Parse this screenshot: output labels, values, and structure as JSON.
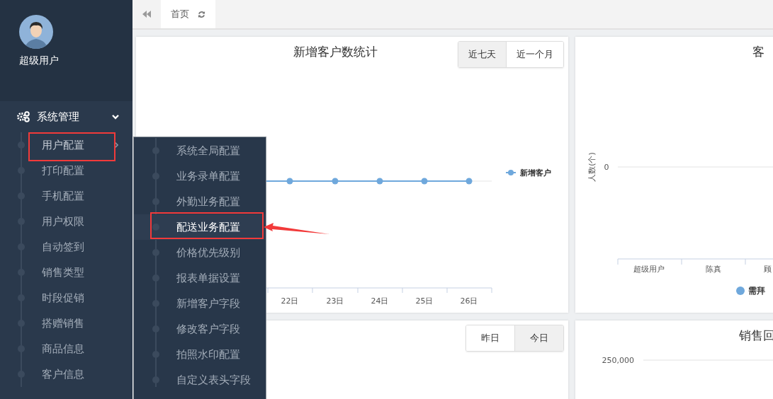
{
  "sidebar": {
    "user_name": "超级用户",
    "menu": {
      "label": "系统管理",
      "expanded": true,
      "children": [
        {
          "label": "用户配置",
          "selected": true
        },
        {
          "label": "打印配置",
          "selected": false
        },
        {
          "label": "手机配置",
          "selected": false
        },
        {
          "label": "用户权限",
          "selected": false
        },
        {
          "label": "自动签到",
          "selected": false
        },
        {
          "label": "销售类型",
          "selected": false
        },
        {
          "label": "时段促销",
          "selected": false
        },
        {
          "label": "搭赠销售",
          "selected": false
        },
        {
          "label": "商品信息",
          "selected": false
        },
        {
          "label": "客户信息",
          "selected": false
        }
      ]
    }
  },
  "submenu": {
    "items": [
      {
        "label": "系统全局配置",
        "selected": false
      },
      {
        "label": "业务录单配置",
        "selected": false
      },
      {
        "label": "外勤业务配置",
        "selected": false
      },
      {
        "label": "配送业务配置",
        "selected": true
      },
      {
        "label": "价格优先级别",
        "selected": false
      },
      {
        "label": "报表单据设置",
        "selected": false
      },
      {
        "label": "新增客户字段",
        "selected": false
      },
      {
        "label": "修改客户字段",
        "selected": false
      },
      {
        "label": "拍照水印配置",
        "selected": false
      },
      {
        "label": "自定义表头字段",
        "selected": false
      }
    ]
  },
  "tabs": [
    {
      "label": "首页",
      "selected": true
    }
  ],
  "new_customer_card": {
    "title": "新增客户数统计",
    "ranges": [
      {
        "label": "近七天",
        "selected": true
      },
      {
        "label": "近一个月",
        "selected": false
      }
    ],
    "x_labels": [
      "22日",
      "23日",
      "24日",
      "25日",
      "26日"
    ],
    "legend": "新增客户"
  },
  "customer_card": {
    "title": "客",
    "y_label": "人数(个)",
    "y_tick": "0",
    "x_labels": [
      "超级用户",
      "陈真",
      "顾"
    ],
    "legend": "需拜"
  },
  "visit_card": {
    "ranges": [
      {
        "label": "昨日",
        "selected": false
      },
      {
        "label": "今日",
        "selected": true
      }
    ]
  },
  "sales_card": {
    "title": "销售回",
    "y_tick": "250,000"
  }
}
